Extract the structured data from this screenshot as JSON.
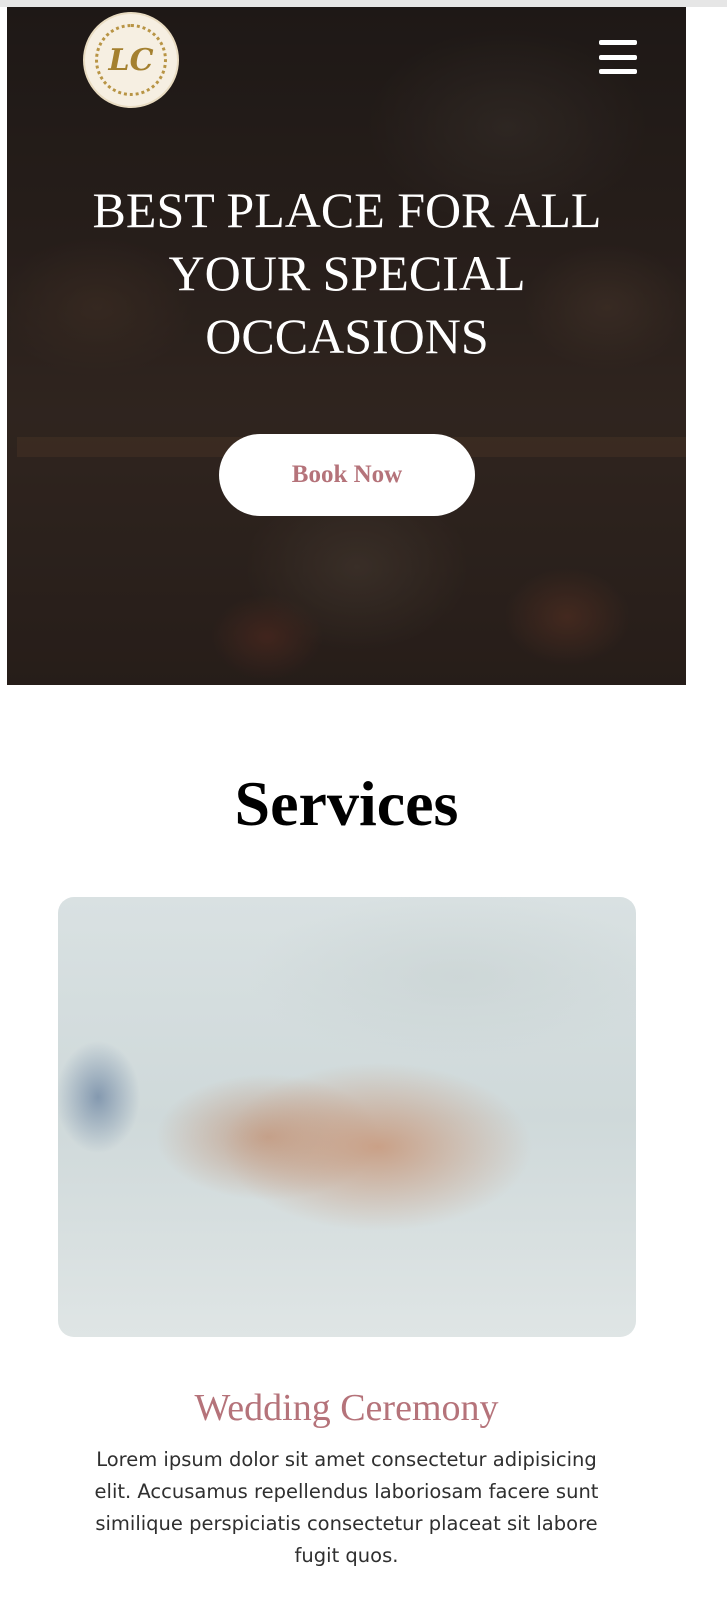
{
  "header": {
    "logo_text": "LC",
    "menu_icon": "hamburger-menu-icon"
  },
  "hero": {
    "title": "BEST PLACE FOR ALL YOUR SPECIAL OCCASIONS",
    "cta_label": "Book Now"
  },
  "services": {
    "heading": "Services",
    "items": [
      {
        "name": "Wedding Ceremony",
        "description": "Lorem ipsum dolor sit amet consectetur adipisicing elit. Accusamus repellendus laboriosam facere sunt similique perspiciatis consectetur placeat sit labore fugit quos."
      }
    ]
  },
  "colors": {
    "accent": "#b5737a",
    "hero_overlay": "#1a1512",
    "text": "#2f2f2f"
  }
}
